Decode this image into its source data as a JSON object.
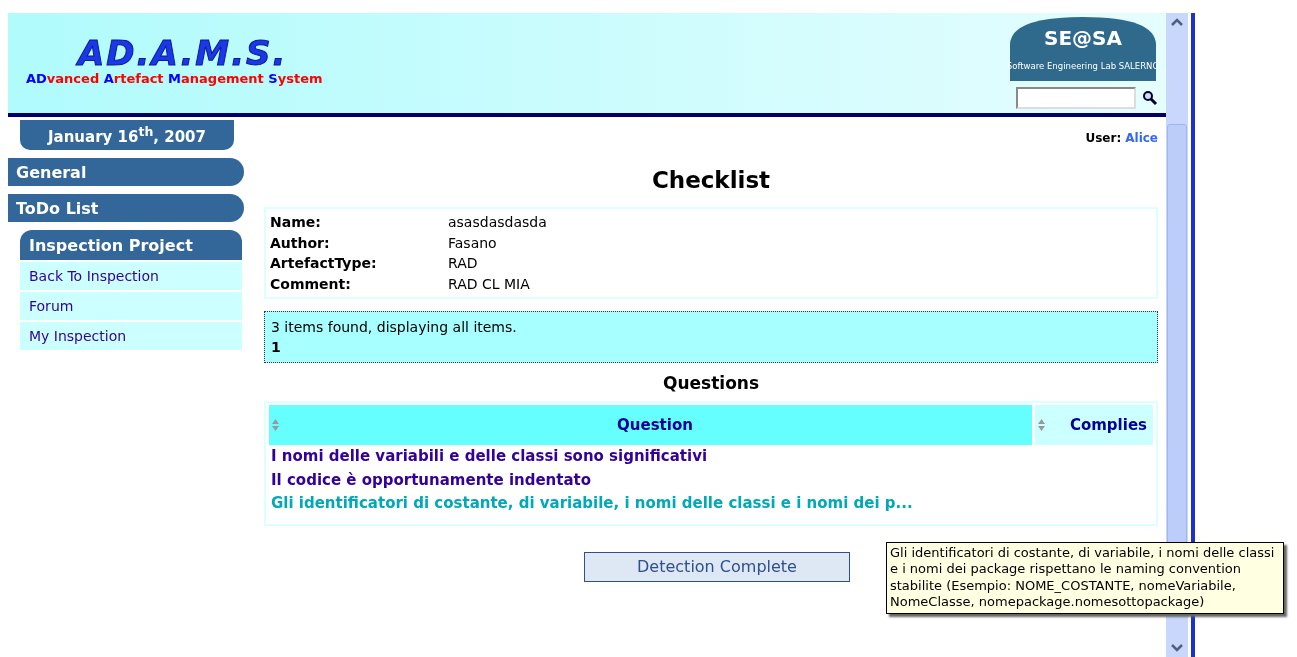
{
  "header": {
    "logo_title": "AD.A.M.S.",
    "subtitle_parts": [
      {
        "text": "AD",
        "color": "#0000ff"
      },
      {
        "text": "vanced ",
        "color": "#ff0000"
      },
      {
        "text": "A",
        "color": "#0000ff"
      },
      {
        "text": "rtefact ",
        "color": "#ff0000"
      },
      {
        "text": "M",
        "color": "#0000ff"
      },
      {
        "text": "anagement ",
        "color": "#ff0000"
      },
      {
        "text": "S",
        "color": "#0000ff"
      },
      {
        "text": "ystem",
        "color": "#ff0000"
      }
    ],
    "lab_logo": {
      "letters": "SE@SA",
      "sub": "Software Engineering Lab SALERNO"
    }
  },
  "date": "January 16$^{th}$, 2007",
  "user": {
    "label": "User:",
    "name": "Alice"
  },
  "sidebar": {
    "menus": [
      "General",
      "ToDo List"
    ],
    "section": {
      "title": "Inspection Project",
      "items": [
        "Back To Inspection",
        "Forum",
        "My Inspection"
      ]
    }
  },
  "title": "Checklist",
  "details": [
    {
      "label": "Name:",
      "value": "asasdasdasda"
    },
    {
      "label": "Author:",
      "value": "Fasano"
    },
    {
      "label": "ArtefactType:",
      "value": "RAD"
    },
    {
      "label": "Comment:",
      "value": "RAD CL MIA"
    }
  ],
  "paging": {
    "summary": "3 items found, displaying all items.",
    "pages": "1"
  },
  "questions": {
    "title": "Questions",
    "columns": [
      {
        "label": "Question",
        "selected": true
      },
      {
        "label": "Complies",
        "selected": false
      }
    ],
    "rows": [
      {
        "text": "I nomi delle variabili e delle classi sono significativi",
        "highlighted": false
      },
      {
        "text": "Il codice è opportunamente indentato",
        "highlighted": false
      },
      {
        "text": "Gli identificatori di costante, di variabile, i nomi delle classi e i nomi dei p...",
        "highlighted": true
      }
    ]
  },
  "button": "Detection Complete",
  "tooltip": "Gli identificatori di costante, di variabile, i nomi delle classi e i nomi dei package rispettano le naming convention stabilite (Esempio: NOME_COSTANTE, nomeVariabile, NomeClasse, nomepackage.nomesottopackage)"
}
